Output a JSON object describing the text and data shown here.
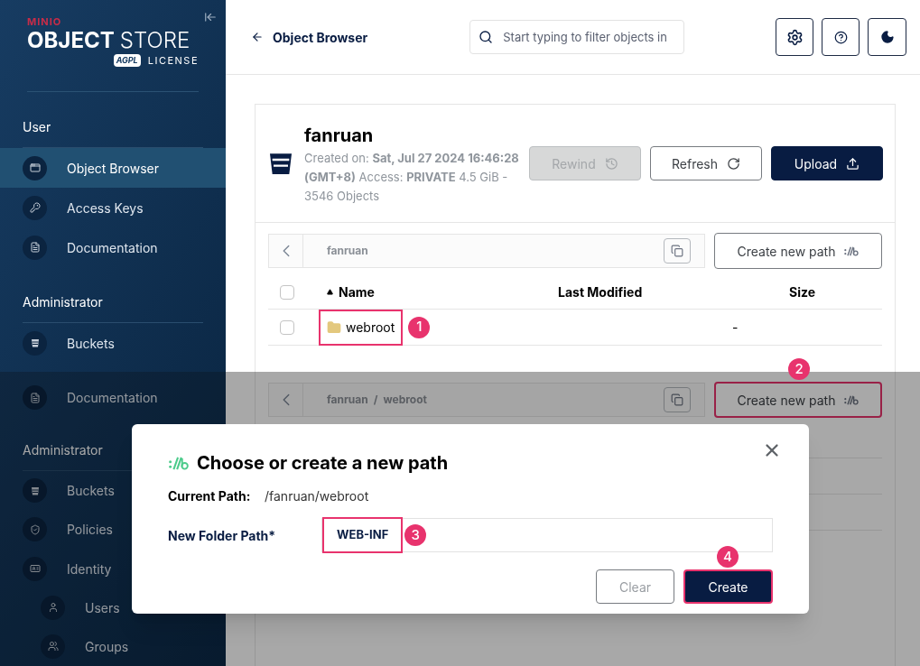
{
  "sidebar_top": {
    "logo": {
      "brand": "MINIO",
      "title_bold": "OBJECT",
      "title_light": "STORE",
      "badge": "AGPL",
      "license": "LICENSE"
    },
    "sections": [
      {
        "heading": "User",
        "items": [
          {
            "label": "Object Browser",
            "selected": true
          },
          {
            "label": "Access Keys",
            "selected": false
          },
          {
            "label": "Documentation",
            "selected": false
          }
        ]
      },
      {
        "heading": "Administrator",
        "items": [
          {
            "label": "Buckets",
            "selected": false
          }
        ]
      }
    ]
  },
  "header": {
    "back_label": "Object Browser",
    "search_placeholder": "Start typing to filter objects in"
  },
  "bucket": {
    "name": "fanruan",
    "details": "Created on: **Sat, Jul 27 2024 16:46:28 (GMT+8)** Access: **PRIVATE** 4.5 GiB - 3546 Objects",
    "buttons": [
      {
        "label": "Rewind",
        "kind": "outline",
        "disabled": true
      },
      {
        "label": "Refresh",
        "kind": "outline",
        "disabled": false
      },
      {
        "label": "Upload",
        "kind": "primary",
        "disabled": false
      }
    ]
  },
  "browser_top": {
    "breadcrumb": [
      "fanruan"
    ],
    "create_path_label": "Create new path",
    "select_all_checked": false,
    "columns": [
      {
        "label": "Name",
        "sorted": true
      },
      {
        "label": "Last Modified",
        "sorted": false
      },
      {
        "label": "Size",
        "sorted": false
      }
    ],
    "rows": [
      {
        "name": "webroot",
        "size": "-",
        "checked": false
      }
    ]
  },
  "sidebar_bottom": {
    "items": [
      {
        "kind": "item",
        "label": "Documentation"
      },
      {
        "kind": "heading",
        "label": "Administrator"
      },
      {
        "kind": "item",
        "label": "Buckets"
      },
      {
        "kind": "item",
        "label": "Policies"
      },
      {
        "kind": "item",
        "label": "Identity"
      },
      {
        "kind": "subitem",
        "label": "Users"
      },
      {
        "kind": "subitem",
        "label": "Groups"
      }
    ]
  },
  "browser_bottom": {
    "breadcrumb": [
      "fanruan",
      "webroot"
    ],
    "separator": "/",
    "create_path_label": "Create new path"
  },
  "dialog": {
    "title": "Choose or create a new path",
    "current_path_label": "Current Path:",
    "current_path": "/fanruan/webroot",
    "new_folder_label": "New Folder Path*",
    "new_folder_value": "WEB-INF",
    "buttons": [
      {
        "label": "Clear",
        "kind": "outline"
      },
      {
        "label": "Create",
        "kind": "primary"
      }
    ]
  },
  "annotations": [
    {
      "number": "1"
    },
    {
      "number": "2"
    },
    {
      "number": "3"
    },
    {
      "number": "4"
    }
  ]
}
